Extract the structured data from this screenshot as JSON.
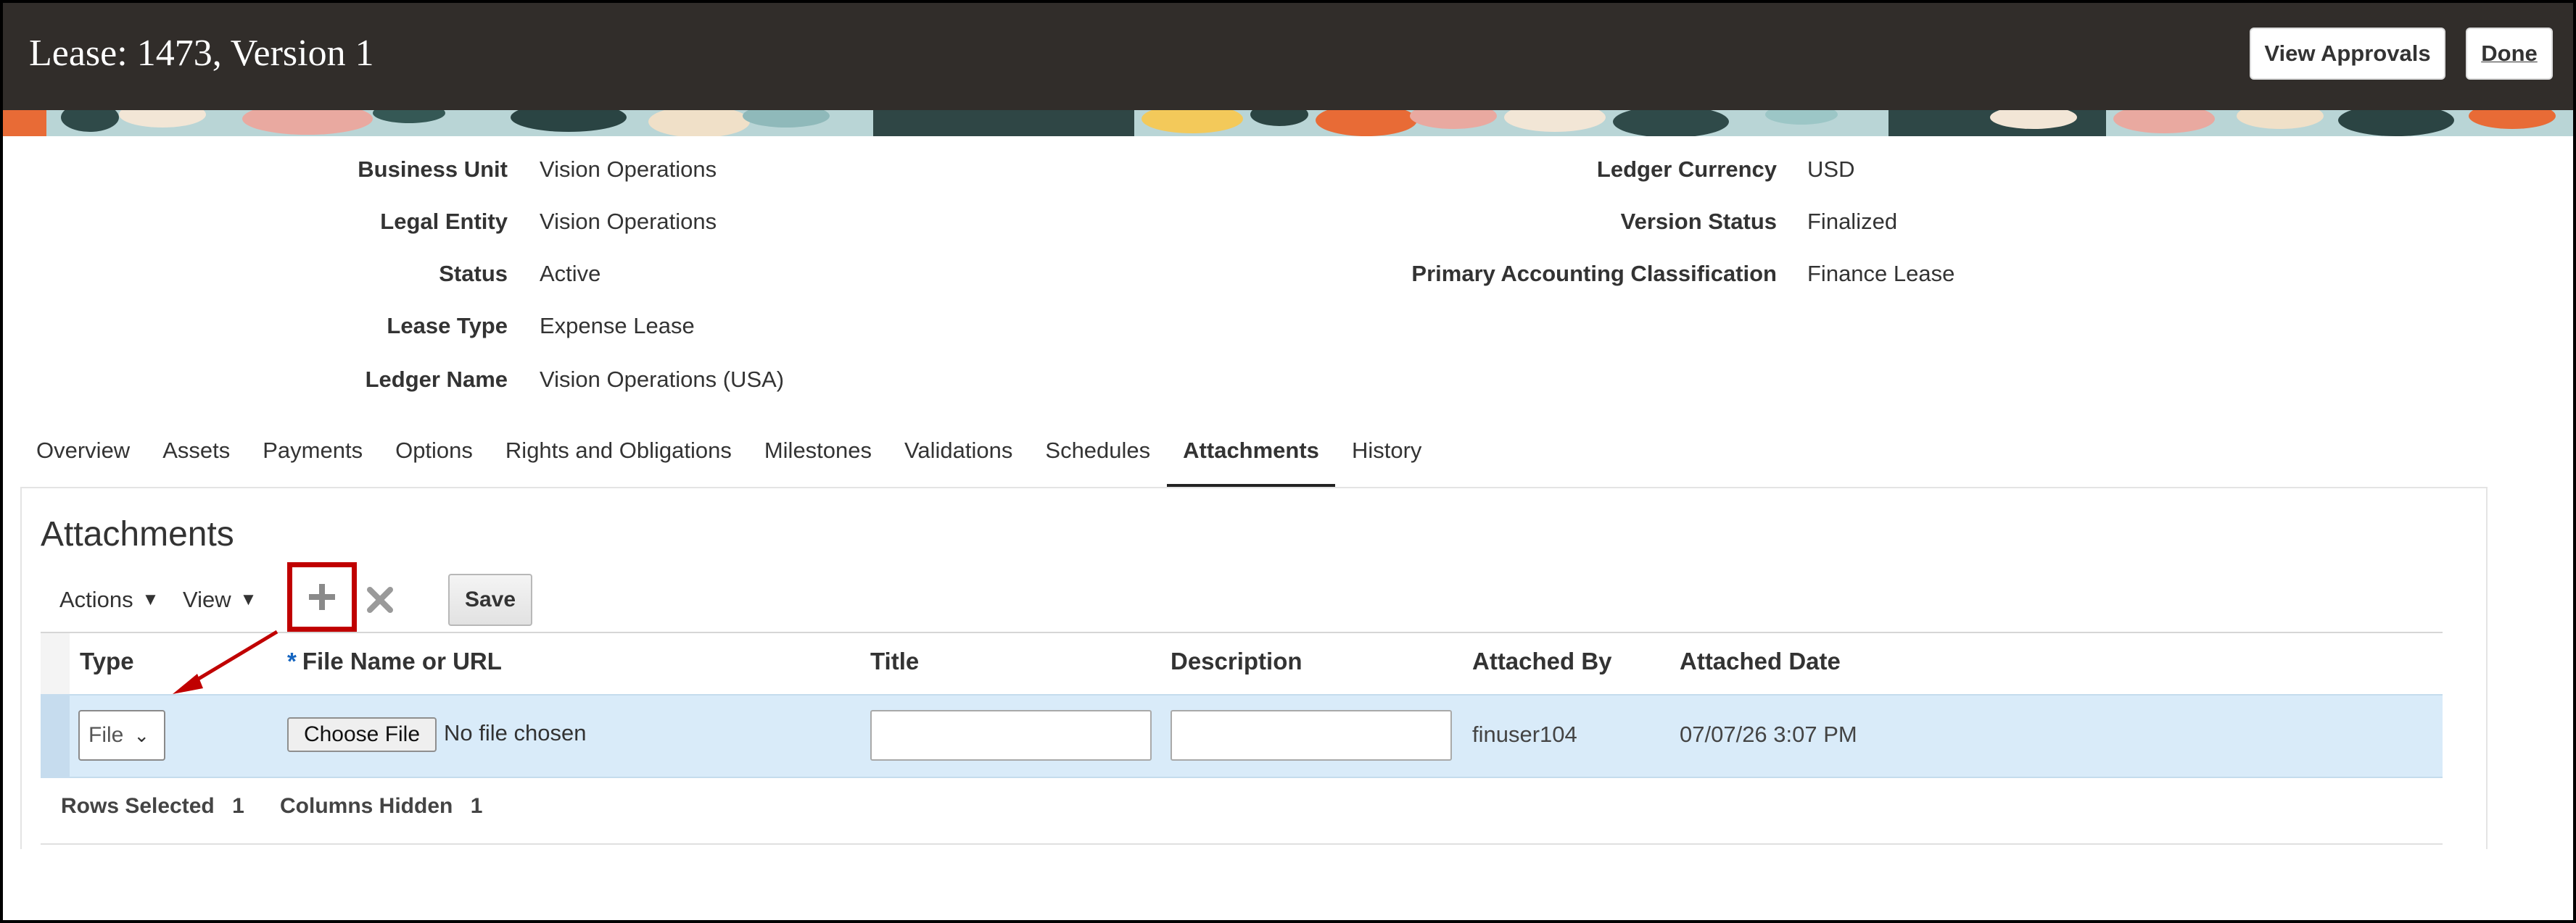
{
  "header": {
    "title": "Lease: 1473, Version 1",
    "view_approvals_label": "View Approvals",
    "done_label": "Done"
  },
  "details": {
    "business_unit_label": "Business Unit",
    "business_unit_value": "Vision Operations",
    "legal_entity_label": "Legal Entity",
    "legal_entity_value": "Vision Operations",
    "status_label": "Status",
    "status_value": "Active",
    "lease_type_label": "Lease Type",
    "lease_type_value": "Expense Lease",
    "ledger_name_label": "Ledger Name",
    "ledger_name_value": "Vision Operations (USA)",
    "ledger_currency_label": "Ledger Currency",
    "ledger_currency_value": "USD",
    "version_status_label": "Version Status",
    "version_status_value": "Finalized",
    "primary_classification_label": "Primary Accounting Classification",
    "primary_classification_value": "Finance Lease"
  },
  "tabs": [
    {
      "label": "Overview"
    },
    {
      "label": "Assets"
    },
    {
      "label": "Payments"
    },
    {
      "label": "Options"
    },
    {
      "label": "Rights and Obligations"
    },
    {
      "label": "Milestones"
    },
    {
      "label": "Validations"
    },
    {
      "label": "Schedules"
    },
    {
      "label": "Attachments",
      "active": true
    },
    {
      "label": "History"
    }
  ],
  "attachments": {
    "title": "Attachments",
    "toolbar": {
      "actions_label": "Actions",
      "view_label": "View",
      "add_icon": "plus-icon",
      "delete_icon": "close-x-icon",
      "save_label": "Save"
    },
    "columns": {
      "type": "Type",
      "file_name_required": "*",
      "file_name": "File Name or URL",
      "title": "Title",
      "description": "Description",
      "attached_by": "Attached By",
      "attached_date": "Attached Date"
    },
    "row": {
      "type_value": "File",
      "choose_file_label": "Choose File",
      "no_file_text": "No file chosen",
      "title_value": "",
      "description_value": "",
      "attached_by": "finuser104",
      "attached_date": "07/07/26 3:07 PM"
    },
    "footer": {
      "rows_selected_label": "Rows Selected",
      "rows_selected_value": "1",
      "columns_hidden_label": "Columns Hidden",
      "columns_hidden_value": "1"
    }
  },
  "colors": {
    "header_bg": "#312d2a",
    "highlight_red": "#c00000",
    "selected_row": "#d9ebf9"
  }
}
